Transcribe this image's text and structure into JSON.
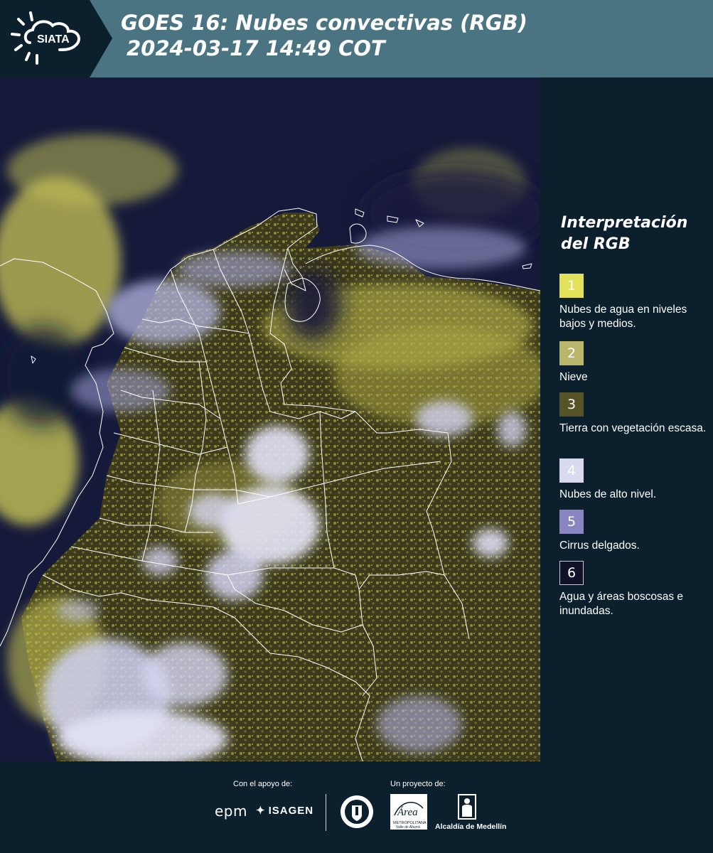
{
  "header": {
    "logo_text": "SIATA",
    "title_line1": "GOES 16: Nubes convectivas (RGB)",
    "title_line2": "2024-03-17 14:49 COT",
    "background_color": "#4b7482"
  },
  "map": {
    "product": "GOES 16 convective clouds RGB",
    "border_color": "#ffffff"
  },
  "legend": {
    "title": "Interpretación del RGB",
    "items": [
      {
        "number": "1",
        "label": "Nubes de agua en niveles bajos y medios.",
        "color": "#e3e05a"
      },
      {
        "number": "2",
        "label": "Nieve",
        "color": "#b9b66c"
      },
      {
        "number": "3",
        "label": "Tierra con vegetación escasa.",
        "color": "#565326"
      },
      {
        "number": "4",
        "label": "Nubes de alto nivel.",
        "color": "#d9d9f1"
      },
      {
        "number": "5",
        "label": "Cirrus delgados.",
        "color": "#8885c0"
      },
      {
        "number": "6",
        "label": "Agua y áreas boscosas e inundadas.",
        "color": "#10122a"
      }
    ]
  },
  "footer": {
    "sponsor_caption": "Con el apoyo de:",
    "project_caption": "Un proyecto de:",
    "sponsors": [
      "epm",
      "ISAGEN"
    ],
    "partners": [
      "Área Metropolitana Valle de Aburrá",
      "Alcaldía de Medellín"
    ],
    "area_logo_text": "Área",
    "area_logo_subtitle": "METROPOLITANA",
    "area_logo_subtitle2": "Valle de Aburrá",
    "alcaldia_label": "Alcaldía de Medellín"
  }
}
